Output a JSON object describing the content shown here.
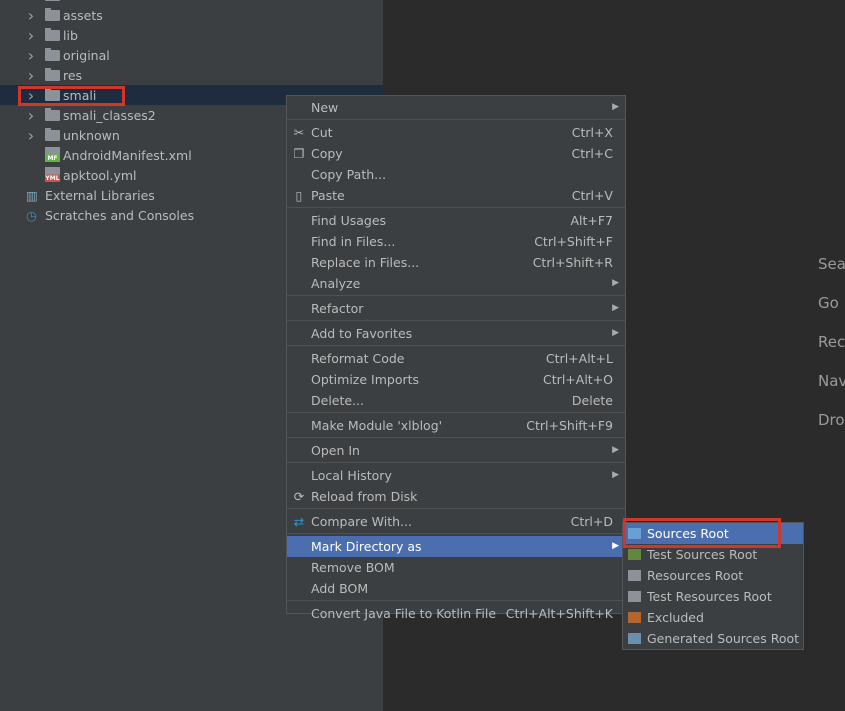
{
  "tree": {
    "items": [
      {
        "label": "",
        "type": "folder",
        "expand": true
      },
      {
        "label": "assets",
        "type": "folder",
        "expand": true
      },
      {
        "label": "lib",
        "type": "folder",
        "expand": true
      },
      {
        "label": "original",
        "type": "folder",
        "expand": true
      },
      {
        "label": "res",
        "type": "folder",
        "expand": true
      },
      {
        "label": "smali",
        "type": "folder",
        "expand": true,
        "selected": true
      },
      {
        "label": "smali_classes2",
        "type": "folder",
        "expand": true
      },
      {
        "label": "unknown",
        "type": "folder",
        "expand": true
      },
      {
        "label": "AndroidManifest.xml",
        "type": "file",
        "badge": "MF",
        "badge_color": "#62b543"
      },
      {
        "label": "apktool.yml",
        "type": "file",
        "badge": "YML",
        "badge_color": "#c75450"
      },
      {
        "label": "External Libraries",
        "type": "libraries"
      },
      {
        "label": "Scratches and Consoles",
        "type": "scratches"
      }
    ]
  },
  "menu": {
    "items": [
      {
        "label": "New",
        "submenu": true
      },
      {
        "sep": true
      },
      {
        "label": "Cut",
        "shortcut": "Ctrl+X",
        "icon": "scissors-icon",
        "glyph": "✂"
      },
      {
        "label": "Copy",
        "shortcut": "Ctrl+C",
        "icon": "copy-icon",
        "glyph": "❐"
      },
      {
        "label": "Copy Path..."
      },
      {
        "label": "Paste",
        "shortcut": "Ctrl+V",
        "icon": "paste-icon",
        "glyph": "▯"
      },
      {
        "sep": true
      },
      {
        "label": "Find Usages",
        "shortcut": "Alt+F7"
      },
      {
        "label": "Find in Files...",
        "shortcut": "Ctrl+Shift+F"
      },
      {
        "label": "Replace in Files...",
        "shortcut": "Ctrl+Shift+R"
      },
      {
        "label": "Analyze",
        "submenu": true
      },
      {
        "sep": true
      },
      {
        "label": "Refactor",
        "submenu": true
      },
      {
        "sep": true
      },
      {
        "label": "Add to Favorites",
        "submenu": true
      },
      {
        "sep": true
      },
      {
        "label": "Reformat Code",
        "shortcut": "Ctrl+Alt+L"
      },
      {
        "label": "Optimize Imports",
        "shortcut": "Ctrl+Alt+O"
      },
      {
        "label": "Delete...",
        "shortcut": "Delete"
      },
      {
        "sep": true
      },
      {
        "label": "Make Module 'xlblog'",
        "shortcut": "Ctrl+Shift+F9"
      },
      {
        "sep": true
      },
      {
        "label": "Open In",
        "submenu": true
      },
      {
        "sep": true
      },
      {
        "label": "Local History",
        "submenu": true
      },
      {
        "label": "Reload from Disk",
        "icon": "reload-icon",
        "glyph": "⟳"
      },
      {
        "sep": true
      },
      {
        "label": "Compare With...",
        "shortcut": "Ctrl+D",
        "icon": "compare-icon",
        "glyph": "⇄"
      },
      {
        "sep": true
      },
      {
        "label": "Mark Directory as",
        "submenu": true,
        "highlighted": true
      },
      {
        "label": "Remove BOM"
      },
      {
        "label": "Add BOM"
      },
      {
        "sep": true
      },
      {
        "label": "Convert Java File to Kotlin File",
        "shortcut": "Ctrl+Alt+Shift+K"
      }
    ]
  },
  "submenu": {
    "items": [
      {
        "label": "Sources Root",
        "color": "#6a9fd4",
        "highlighted": true
      },
      {
        "label": "Test Sources Root",
        "color": "#62883c"
      },
      {
        "label": "Resources Root",
        "color": "#8c9297"
      },
      {
        "label": "Test Resources Root",
        "color": "#8c9297"
      },
      {
        "label": "Excluded",
        "color": "#b5662f"
      },
      {
        "label": "Generated Sources Root",
        "color": "#6a8fb0"
      }
    ]
  },
  "editor_hints": [
    "Sea",
    "Go",
    "Rec",
    "Nav",
    "Dro"
  ]
}
